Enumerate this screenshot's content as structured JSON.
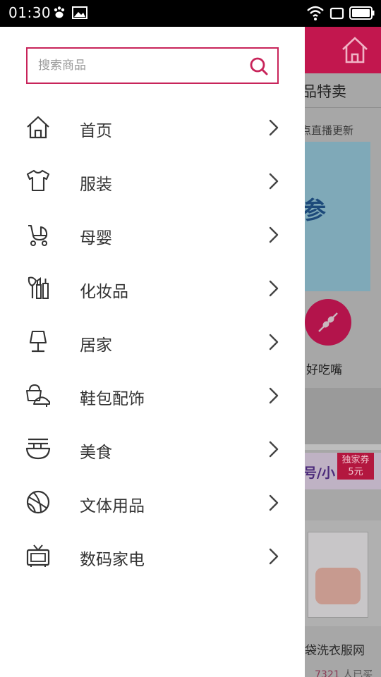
{
  "status_bar": {
    "time": "01:30"
  },
  "search": {
    "placeholder": "搜索商品"
  },
  "menu": {
    "items": [
      {
        "label": "首页",
        "icon": "home-icon"
      },
      {
        "label": "服装",
        "icon": "tshirt-icon"
      },
      {
        "label": "母婴",
        "icon": "stroller-icon"
      },
      {
        "label": "化妆品",
        "icon": "makeup-icon"
      },
      {
        "label": "居家",
        "icon": "lamp-icon"
      },
      {
        "label": "鞋包配饰",
        "icon": "shoe-bag-icon"
      },
      {
        "label": "美食",
        "icon": "noodle-bowl-icon"
      },
      {
        "label": "文体用品",
        "icon": "basketball-icon"
      },
      {
        "label": "数码家电",
        "icon": "tv-icon"
      }
    ]
  },
  "background_page": {
    "title": "品特卖",
    "live_text": "点直播更新",
    "circle_label": "好吃嘴",
    "ad_text": "号/小",
    "badge_line1": "独家券",
    "badge_line2": "5元",
    "product_name": "袋洗衣服网",
    "sold_count": "7321",
    "sold_suffix": "人已买"
  },
  "colors": {
    "accent": "#c8245a",
    "header_brand": "#c2174e"
  }
}
